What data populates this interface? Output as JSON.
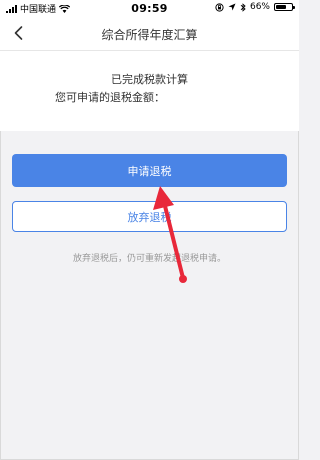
{
  "status_bar": {
    "carrier": "中国联通",
    "time": "09:59",
    "battery_percent": "66%",
    "battery_level": 0.66
  },
  "header": {
    "title": "综合所得年度汇算"
  },
  "result": {
    "title": "已完成税款计算",
    "amount_label": "您可申请的退税金额："
  },
  "actions": {
    "apply_label": "申请退税",
    "abandon_label": "放弃退税",
    "hint": "放弃退税后，仍可重新发起退税申请。"
  },
  "colors": {
    "accent": "#4a84e6",
    "annotation": "#e8283a"
  }
}
